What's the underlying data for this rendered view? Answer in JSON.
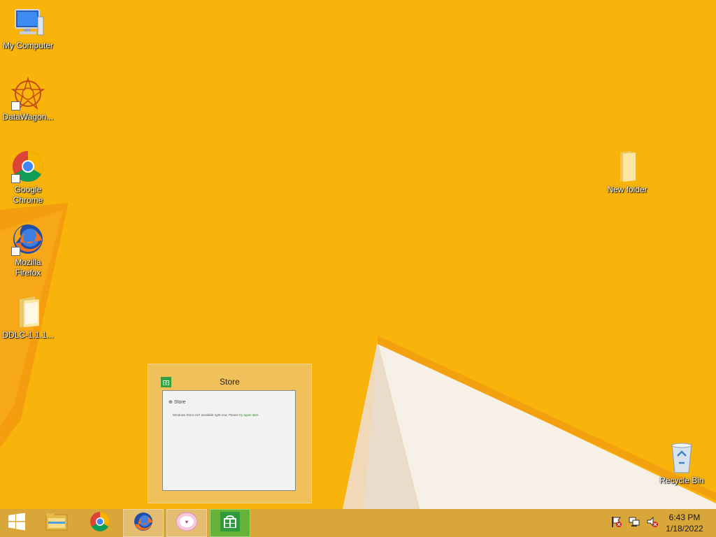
{
  "desktop_icons": [
    {
      "label": "My Computer",
      "icon": "computer-icon"
    },
    {
      "label": "DataWagon...",
      "icon": "datawagon-icon"
    },
    {
      "label": "Google\nChrome",
      "icon": "chrome-icon"
    },
    {
      "label": "Mozilla\nFirefox",
      "icon": "firefox-icon"
    },
    {
      "label": "DDLC-1.1.1...",
      "icon": "folder-icon"
    },
    {
      "label": "New folder",
      "icon": "folder-icon"
    },
    {
      "label": "Recycle Bin",
      "icon": "recycle-bin-icon"
    }
  ],
  "preview": {
    "title": "Store",
    "window_title": "Store",
    "message": "Windows Store isn't available right now. Please",
    "message_link": "try again later."
  },
  "taskbar": {
    "items": [
      "start-icon",
      "file-explorer-icon",
      "chrome-icon",
      "firefox-icon",
      "app-icon",
      "store-icon"
    ]
  },
  "clock": {
    "time": "6:43 PM",
    "date": "1/18/2022"
  },
  "colors": {
    "wallpaper": "#f8b40a",
    "taskbar": "#d9a63a",
    "store_green": "#66b33a"
  }
}
